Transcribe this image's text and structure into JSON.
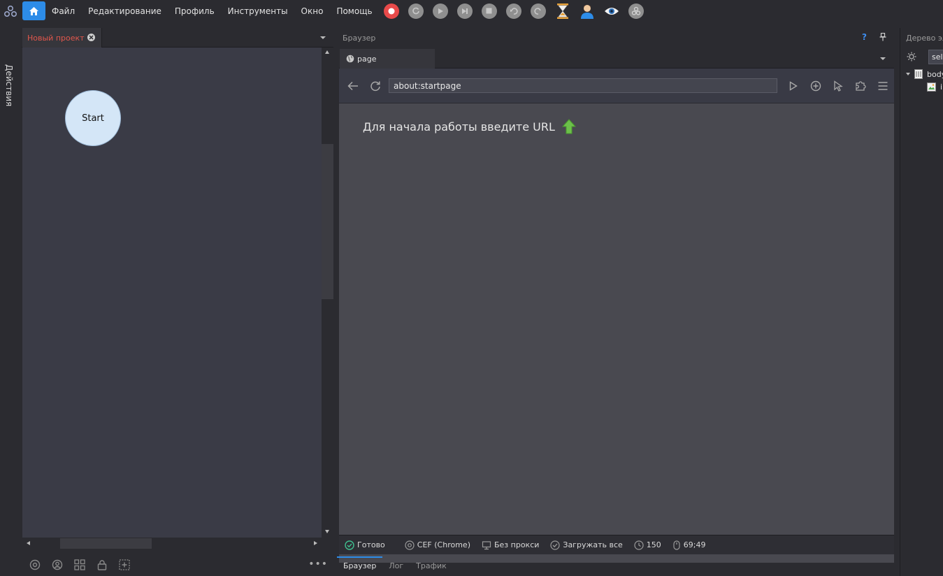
{
  "menu": {
    "items": [
      "Файл",
      "Редактирование",
      "Профиль",
      "Инструменты",
      "Окно",
      "Помощь"
    ]
  },
  "toolbar": {
    "icons": [
      "record-icon",
      "restart-icon",
      "play-icon",
      "step-icon",
      "stop-icon",
      "undo-icon",
      "redo-icon",
      "hourglass-icon",
      "user-icon",
      "eye-icon",
      "logo-icon"
    ]
  },
  "left_strip": {
    "label": "Действия"
  },
  "project": {
    "tab_label": "Новый проект",
    "start_node": "Start"
  },
  "browser": {
    "title": "Браузер",
    "help": "?",
    "tab_label": "page",
    "url": "about:startpage",
    "message": "Для начала работы введите URL",
    "status": {
      "ready": "Готово",
      "engine": "CEF (Chrome)",
      "proxy": "Без прокси",
      "load": "Загружать все",
      "timer": "150",
      "mouse": "69;49"
    },
    "bottom_tabs": [
      "Браузер",
      "Лог",
      "Трафик"
    ]
  },
  "tree": {
    "title": "Дерево элементов",
    "select_value": "selector",
    "node": "body",
    "child": "img"
  },
  "colors": {
    "accent": "#2d8ce8",
    "record": "#e84a4a",
    "project_tab": "#e2574c",
    "upload_arrow": "#6cc04a"
  }
}
